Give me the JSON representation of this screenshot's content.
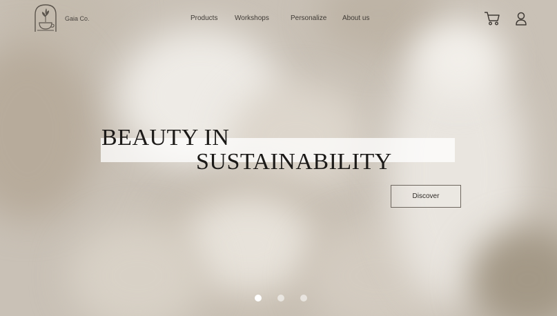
{
  "header": {
    "brand": "Gaia Co.",
    "logo_icon": "teacup-plant-arch-icon",
    "nav": [
      {
        "label": "Products"
      },
      {
        "label": "Workshops"
      },
      {
        "label": "Personalize"
      },
      {
        "label": "About us"
      }
    ],
    "icons": [
      "cart-icon",
      "user-icon"
    ]
  },
  "hero": {
    "headline_line1": "BEAUTY IN",
    "headline_line2": "SUSTAINABILITY",
    "cta_label": "Discover",
    "slides_total": 3,
    "active_slide": 1
  },
  "colors": {
    "accent_text": "#1c1a18",
    "ui_text": "#3f3a35",
    "band": "#ffffff"
  }
}
